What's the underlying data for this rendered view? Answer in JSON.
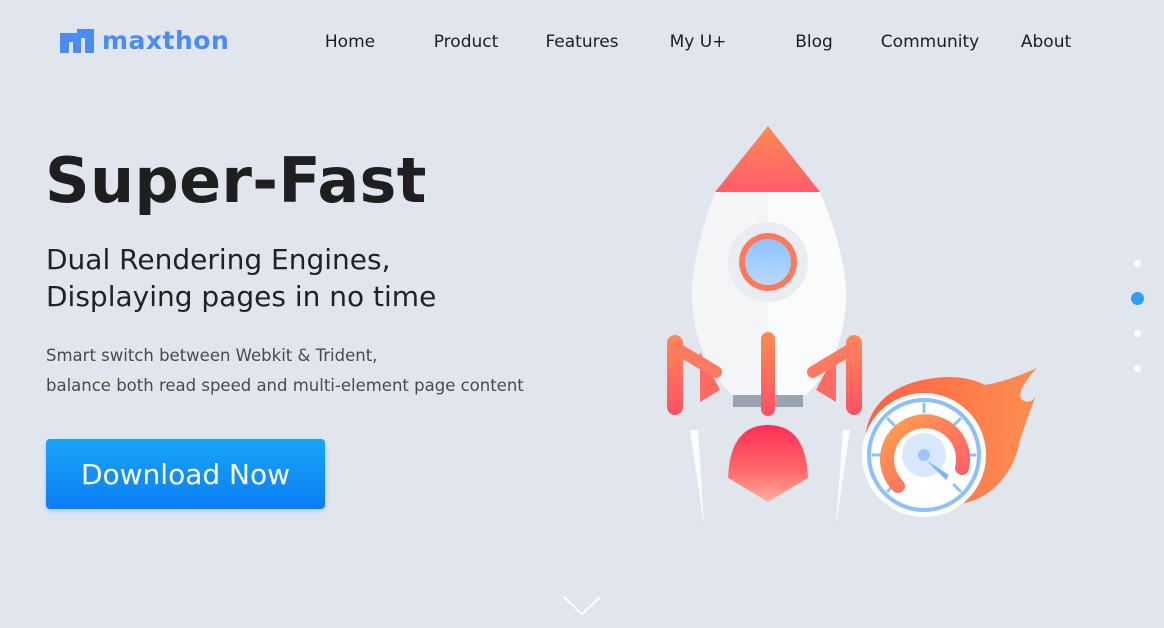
{
  "brand": {
    "name": "maxthon",
    "accent": "#4a8cf6"
  },
  "nav": {
    "items": [
      {
        "label": "Home"
      },
      {
        "label": "Product"
      },
      {
        "label": "Features"
      },
      {
        "label": "My U+"
      },
      {
        "label": "Blog"
      },
      {
        "label": "Community"
      },
      {
        "label": "About"
      }
    ]
  },
  "hero": {
    "title": "Super-Fast",
    "subtitle_line1": "Dual Rendering Engines,",
    "subtitle_line2": "Displaying pages in no time",
    "desc_line1": "Smart switch between Webkit & Trident,",
    "desc_line2": "balance both read speed and multi-element page content",
    "cta_label": "Download Now",
    "cta_color": "#0b7df5"
  },
  "carousel": {
    "slide_count": 4,
    "active_index": 1,
    "active_color": "#2f9ff5"
  },
  "icons": {
    "scroll": "chevron-down-icon",
    "illustration": "rocket-speedometer-illustration"
  }
}
